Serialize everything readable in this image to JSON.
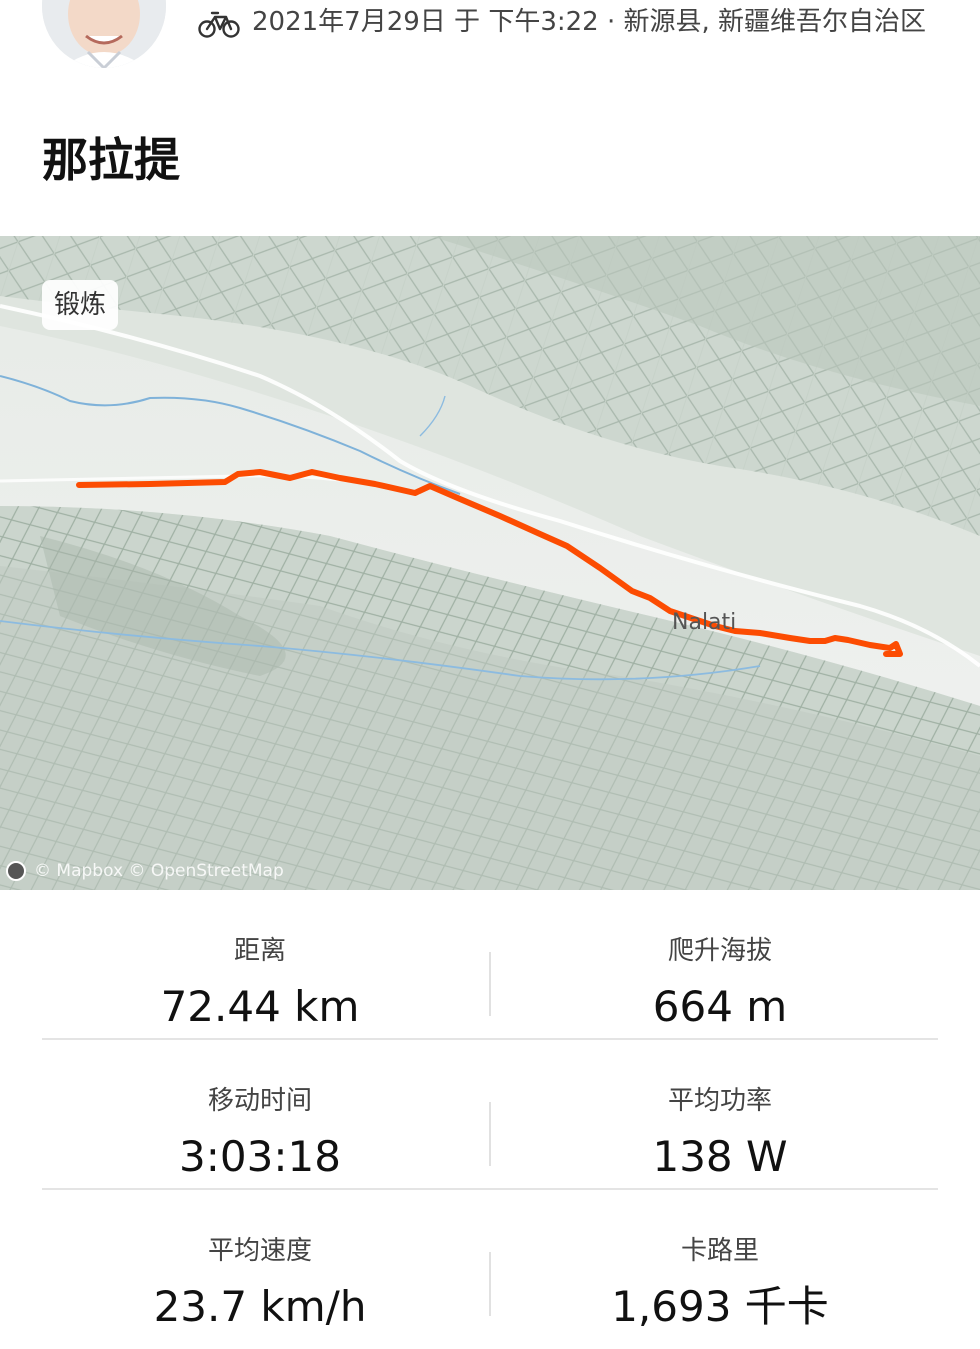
{
  "activity": {
    "sport_icon": "bicycle-icon",
    "meta_text": "2021年7月29日 于 下午3:22 · 新源县, 新疆维吾尔自治区",
    "title": "那拉提"
  },
  "map": {
    "badge_label": "锻炼",
    "attribution": "© Mapbox © OpenStreetMap",
    "town_label": "Nalati",
    "route_color": "#fc4c02"
  },
  "stats": [
    {
      "left": {
        "label": "距离",
        "value": "72.44 km"
      },
      "right": {
        "label": "爬升海拔",
        "value": "664 m"
      }
    },
    {
      "left": {
        "label": "移动时间",
        "value": "3:03:18"
      },
      "right": {
        "label": "平均功率",
        "value": "138 W"
      }
    },
    {
      "left": {
        "label": "平均速度",
        "value": "23.7 km/h"
      },
      "right": {
        "label": "卡路里",
        "value": "1,693 千卡"
      }
    }
  ]
}
